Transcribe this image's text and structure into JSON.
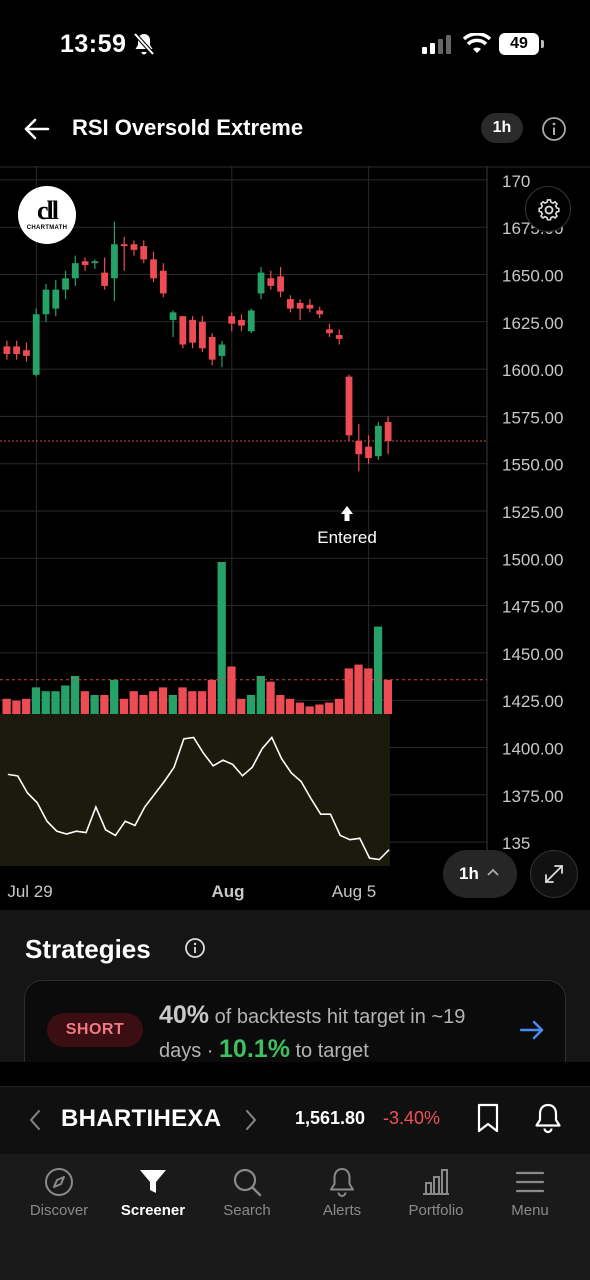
{
  "status_bar": {
    "time": "13:59",
    "battery": "49"
  },
  "header": {
    "title": "RSI Oversold Extreme",
    "timeframe": "1h"
  },
  "chart": {
    "logo_mark": "cll",
    "logo_text": "CHARTMATH",
    "entry_label": "Entered",
    "timeframe_button": "1h",
    "y_ticks": [
      "170",
      "1675.00",
      "1650.00",
      "1625.00",
      "1600.00",
      "1575.00",
      "1550.00",
      "1525.00",
      "1500.00",
      "1475.00",
      "1450.00",
      "1425.00",
      "1400.00",
      "1375.00",
      "135"
    ],
    "x_ticks": [
      {
        "label": "Jul 29",
        "bold": false
      },
      {
        "label": "Aug",
        "bold": true
      },
      {
        "label": "Aug 5",
        "bold": false
      }
    ],
    "colors": {
      "up": "#26a269",
      "down": "#ee4c55",
      "rsi_line": "#ffffff",
      "rsi_zone": "#1c1a0c",
      "reference_line": "#d04545"
    }
  },
  "chart_data": {
    "type": "candlestick",
    "title": "",
    "y_unit": "price",
    "ylim": [
      1340,
      1710
    ],
    "entry_candle_index": 31,
    "current_price_line": 1562,
    "candles": [
      {
        "o": 1612,
        "h": 1615,
        "l": 1605,
        "c": 1608
      },
      {
        "o": 1612,
        "h": 1615,
        "l": 1605,
        "c": 1608
      },
      {
        "o": 1610,
        "h": 1614,
        "l": 1604,
        "c": 1607
      },
      {
        "o": 1597,
        "h": 1632,
        "l": 1596,
        "c": 1629
      },
      {
        "o": 1629,
        "h": 1645,
        "l": 1625,
        "c": 1642
      },
      {
        "o": 1632,
        "h": 1647,
        "l": 1628,
        "c": 1642
      },
      {
        "o": 1642,
        "h": 1652,
        "l": 1637,
        "c": 1648
      },
      {
        "o": 1648,
        "h": 1660,
        "l": 1644,
        "c": 1656
      },
      {
        "o": 1657,
        "h": 1659,
        "l": 1652,
        "c": 1655
      },
      {
        "o": 1656,
        "h": 1658,
        "l": 1653,
        "c": 1657
      },
      {
        "o": 1651,
        "h": 1659,
        "l": 1642,
        "c": 1644
      },
      {
        "o": 1648,
        "h": 1678,
        "l": 1636,
        "c": 1666
      },
      {
        "o": 1666,
        "h": 1670,
        "l": 1652,
        "c": 1665
      },
      {
        "o": 1666,
        "h": 1668,
        "l": 1660,
        "c": 1663
      },
      {
        "o": 1665,
        "h": 1668,
        "l": 1656,
        "c": 1658
      },
      {
        "o": 1658,
        "h": 1662,
        "l": 1646,
        "c": 1648
      },
      {
        "o": 1652,
        "h": 1656,
        "l": 1638,
        "c": 1640
      },
      {
        "o": 1626,
        "h": 1631,
        "l": 1617,
        "c": 1630
      },
      {
        "o": 1628,
        "h": 1628,
        "l": 1611,
        "c": 1613
      },
      {
        "o": 1626,
        "h": 1628,
        "l": 1611,
        "c": 1614
      },
      {
        "o": 1625,
        "h": 1628,
        "l": 1609,
        "c": 1611
      },
      {
        "o": 1617,
        "h": 1619,
        "l": 1602,
        "c": 1605
      },
      {
        "o": 1607,
        "h": 1615,
        "l": 1601,
        "c": 1613
      },
      {
        "o": 1628,
        "h": 1630,
        "l": 1620,
        "c": 1624
      },
      {
        "o": 1626,
        "h": 1629,
        "l": 1620,
        "c": 1623
      },
      {
        "o": 1620,
        "h": 1632,
        "l": 1619,
        "c": 1631
      },
      {
        "o": 1640,
        "h": 1654,
        "l": 1637,
        "c": 1651
      },
      {
        "o": 1648,
        "h": 1652,
        "l": 1642,
        "c": 1644
      },
      {
        "o": 1649,
        "h": 1654,
        "l": 1638,
        "c": 1641
      },
      {
        "o": 1637,
        "h": 1639,
        "l": 1630,
        "c": 1632
      },
      {
        "o": 1635,
        "h": 1637,
        "l": 1626,
        "c": 1632
      },
      {
        "o": 1634,
        "h": 1637,
        "l": 1630,
        "c": 1632
      },
      {
        "o": 1631,
        "h": 1633,
        "l": 1627,
        "c": 1629
      },
      {
        "o": 1621,
        "h": 1624,
        "l": 1617,
        "c": 1619
      },
      {
        "o": 1618,
        "h": 1621,
        "l": 1613,
        "c": 1616
      },
      {
        "o": 1596,
        "h": 1597,
        "l": 1562,
        "c": 1565
      },
      {
        "o": 1562,
        "h": 1571,
        "l": 1546,
        "c": 1555
      },
      {
        "o": 1559,
        "h": 1565,
        "l": 1550,
        "c": 1553
      },
      {
        "o": 1554,
        "h": 1572,
        "l": 1552,
        "c": 1570
      },
      {
        "o": 1572,
        "h": 1575,
        "l": 1555,
        "c": 1562
      }
    ],
    "volume": [
      8,
      7,
      8,
      14,
      12,
      12,
      15,
      20,
      12,
      10,
      10,
      18,
      8,
      12,
      10,
      12,
      14,
      10,
      14,
      12,
      12,
      18,
      80,
      25,
      8,
      10,
      20,
      17,
      10,
      8,
      6,
      4,
      5,
      6,
      8,
      24,
      26,
      24,
      46,
      18
    ],
    "volume_reference": 18,
    "rsi": [
      61,
      60,
      48,
      41,
      28,
      21,
      19,
      21,
      20,
      38,
      22,
      18,
      28,
      25,
      38,
      47,
      56,
      66,
      86,
      87,
      76,
      67,
      71,
      68,
      60,
      66,
      79,
      87,
      72,
      62,
      56,
      44,
      33,
      33,
      18,
      15,
      16,
      2,
      1,
      8
    ]
  },
  "strategies": {
    "title": "Strategies",
    "badge": "SHORT",
    "pct": "40%",
    "text_a": "of backtests hit target in ~19 days ·",
    "target": "10.1%",
    "text_b": "to target"
  },
  "stock": {
    "symbol": "BHARTIHEXA",
    "price": "1,561.80",
    "change": "-3.40%"
  },
  "nav": [
    {
      "label": "Discover",
      "icon": "compass-icon",
      "active": false
    },
    {
      "label": "Screener",
      "icon": "filter-icon",
      "active": true
    },
    {
      "label": "Search",
      "icon": "search-icon",
      "active": false
    },
    {
      "label": "Alerts",
      "icon": "bell-icon",
      "active": false
    },
    {
      "label": "Portfolio",
      "icon": "bar-chart-icon",
      "active": false
    },
    {
      "label": "Menu",
      "icon": "menu-icon",
      "active": false
    }
  ]
}
